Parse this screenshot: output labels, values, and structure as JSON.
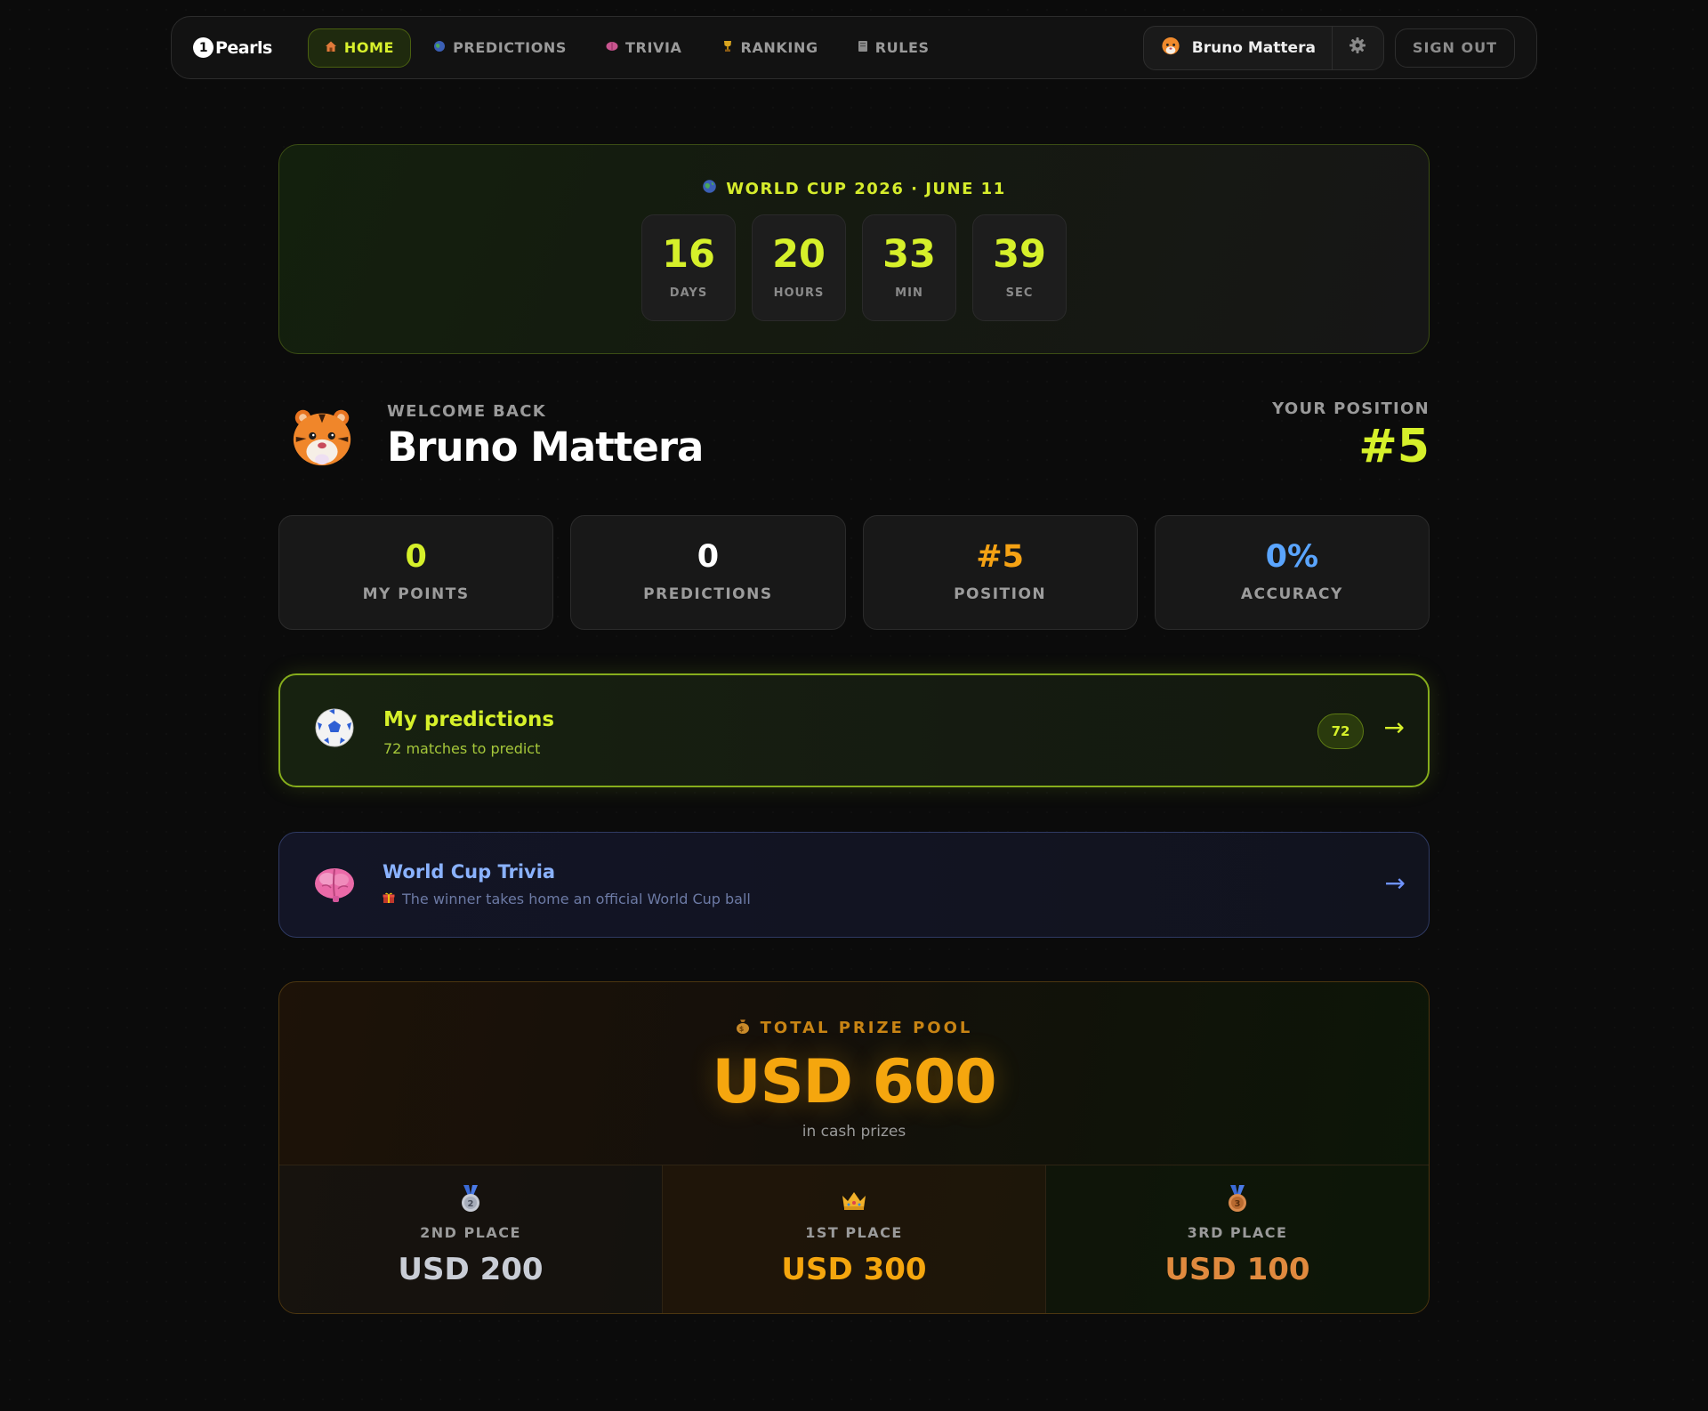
{
  "nav": {
    "logo_mark": "1",
    "logo_text": "Pearls",
    "links": [
      {
        "label": "HOME",
        "icon": "house-icon",
        "active": true
      },
      {
        "label": "PREDICTIONS",
        "icon": "globe-icon",
        "active": false
      },
      {
        "label": "TRIVIA",
        "icon": "brain-icon",
        "active": false
      },
      {
        "label": "RANKING",
        "icon": "trophy-icon",
        "active": false
      },
      {
        "label": "RULES",
        "icon": "book-icon",
        "active": false
      }
    ],
    "user_name": "Bruno Mattera",
    "signout_label": "SIGN OUT"
  },
  "countdown": {
    "title": "WORLD CUP 2026 · JUNE 11",
    "units": [
      {
        "value": "16",
        "label": "DAYS"
      },
      {
        "value": "20",
        "label": "HOURS"
      },
      {
        "value": "33",
        "label": "MIN"
      },
      {
        "value": "39",
        "label": "SEC"
      }
    ]
  },
  "welcome": {
    "sub": "WELCOME BACK",
    "name": "Bruno Mattera",
    "position_label": "YOUR POSITION",
    "position_value": "#5"
  },
  "stats": [
    {
      "value": "0",
      "label": "MY POINTS",
      "color": "#d6f02a"
    },
    {
      "value": "0",
      "label": "PREDICTIONS",
      "color": "#ffffff"
    },
    {
      "value": "#5",
      "label": "POSITION",
      "color": "#f5a214"
    },
    {
      "value": "0%",
      "label": "ACCURACY",
      "color": "#5aa5ff"
    }
  ],
  "predictions_card": {
    "title": "My predictions",
    "subtitle": "72 matches to predict",
    "badge": "72",
    "arrow": "→"
  },
  "trivia_card": {
    "title": "World Cup Trivia",
    "subtitle": "The winner takes home an official World Cup ball",
    "arrow": "→"
  },
  "prize": {
    "label": "TOTAL PRIZE POOL",
    "amount": "USD 600",
    "note": "in cash prizes",
    "places": [
      {
        "label": "2ND PLACE",
        "amount": "USD 200",
        "color": "#c9cdd6",
        "icon": "silver-medal-icon"
      },
      {
        "label": "1ST PLACE",
        "amount": "USD 300",
        "color": "#f5a60e",
        "icon": "crown-icon"
      },
      {
        "label": "3RD PLACE",
        "amount": "USD 100",
        "color": "#e08a3e",
        "icon": "bronze-medal-icon"
      }
    ]
  }
}
